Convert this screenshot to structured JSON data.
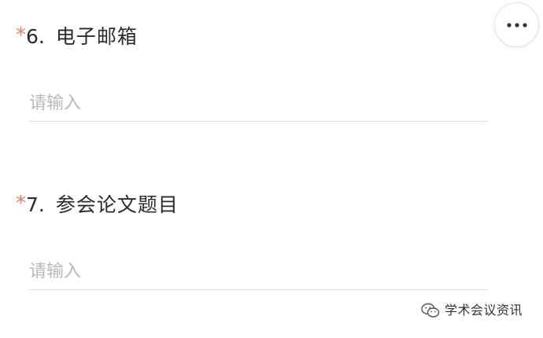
{
  "menu": {
    "icon": "more-horizontal-icon"
  },
  "questions": [
    {
      "required_mark": "*",
      "number": "6.",
      "label": "电子邮箱",
      "placeholder": "请输入",
      "value": ""
    },
    {
      "required_mark": "*",
      "number": "7.",
      "label": "参会论文题目",
      "placeholder": "请输入",
      "value": ""
    }
  ],
  "watermark": {
    "icon": "wechat-logo-icon",
    "text": "学术会议资讯"
  },
  "colors": {
    "required_star": "#d8816b",
    "title_text": "#2b2b2b",
    "placeholder_text": "#b9b9b9",
    "underline": "#dcdcdc"
  }
}
